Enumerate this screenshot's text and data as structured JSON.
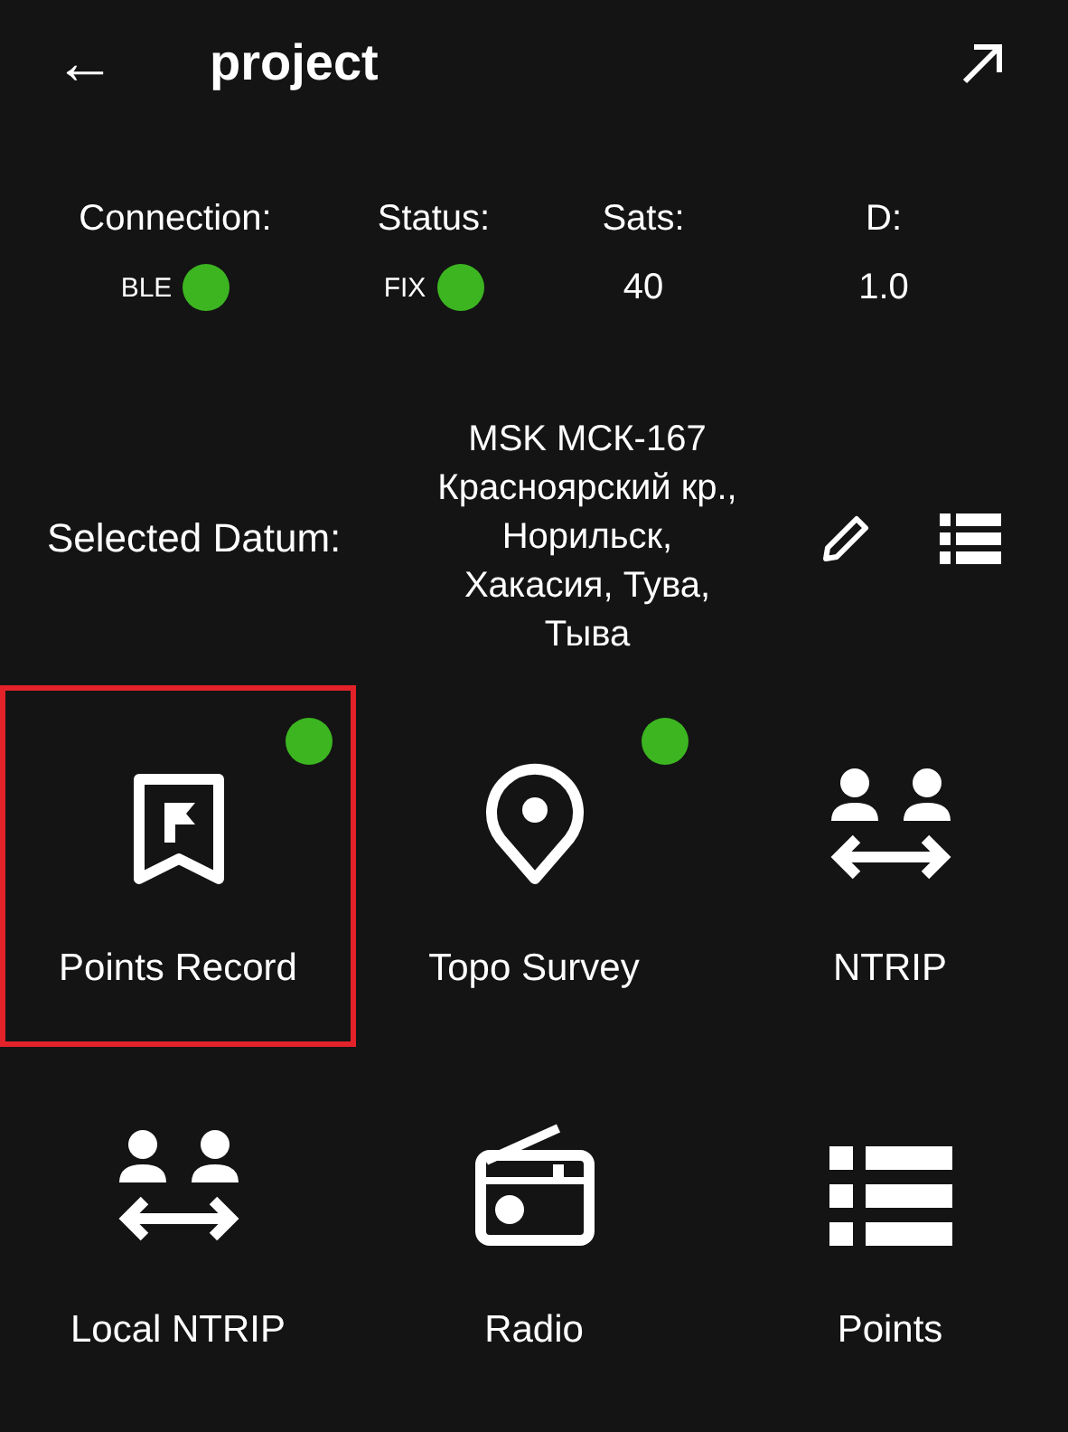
{
  "header": {
    "back": "←",
    "title": "project"
  },
  "status": [
    {
      "kind": "indicator",
      "label": "Connection:",
      "value": "BLE",
      "color": "#3cb521"
    },
    {
      "kind": "indicator",
      "label": "Status:",
      "value": "FIX",
      "color": "#3cb521"
    },
    {
      "kind": "value",
      "label": "Sats:",
      "value": "40"
    },
    {
      "kind": "value",
      "label": "D:",
      "value": "1.0"
    }
  ],
  "datum": {
    "label": "Selected Datum:",
    "value": "MSK МСК-167 Красноярский кр., Норильск, Хакасия, Тува, Тыва"
  },
  "tiles": [
    {
      "kind": "flag",
      "label": "Points Record",
      "active": true,
      "selected": true
    },
    {
      "kind": "pin",
      "label": "Topo Survey",
      "active": true,
      "selected": false
    },
    {
      "kind": "exchange",
      "label": "NTRIP",
      "active": false,
      "selected": false
    },
    {
      "kind": "exchange",
      "label": "Local NTRIP",
      "active": false,
      "selected": false
    },
    {
      "kind": "radio",
      "label": "Radio",
      "active": false,
      "selected": false
    },
    {
      "kind": "list",
      "label": "Points",
      "active": false,
      "selected": false
    }
  ]
}
